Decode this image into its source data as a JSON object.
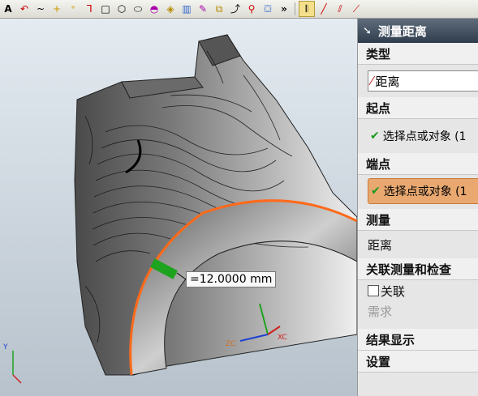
{
  "toolbar": {
    "items": [
      "text-icon",
      "arc-icon",
      "spline-icon",
      "point-icon",
      "point-set-icon",
      "line-icon",
      "rectangle-icon",
      "polygon-icon",
      "ellipse-icon",
      "curve-icon",
      "face-icon",
      "section-icon",
      "law-icon",
      "offset-icon",
      "bridge-icon",
      "join-icon",
      "project-icon",
      "more-icon",
      "snap-icon",
      "line-tool-icon",
      "parallel-icon",
      "tangent-icon"
    ]
  },
  "dimension": {
    "value": "=12.0000 mm"
  },
  "panel": {
    "title": "测量距离",
    "type": {
      "header": "类型",
      "value": "距离"
    },
    "start": {
      "header": "起点",
      "selection": "选择点或对象 (1"
    },
    "end": {
      "header": "端点",
      "selection": "选择点或对象 (1"
    },
    "measure": {
      "header": "测量",
      "value": "距离"
    },
    "assoc": {
      "header": "关联测量和检查",
      "checkbox": "关联",
      "requirement": "需求"
    },
    "result": {
      "header": "结果显示"
    },
    "settings": {
      "header": "设置"
    }
  },
  "axes": {
    "main": {
      "x": "XC",
      "z": "ZC"
    },
    "corner": {
      "y": "Y"
    }
  },
  "colors": {
    "selection_edge": "#ff6a1a",
    "dimension_mark": "#1ea31e",
    "active_selection": "#e8a870",
    "panel_title": "#3a4a5a"
  }
}
